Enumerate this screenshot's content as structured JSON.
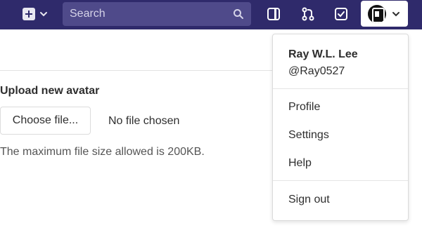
{
  "navbar": {
    "search_placeholder": "Search",
    "icons": [
      "plus-square-icon",
      "chevron-down-icon",
      "search-icon",
      "sidebar-toggle-icon",
      "merge-request-icon",
      "todo-check-icon",
      "user-avatar",
      "chevron-down-icon"
    ]
  },
  "avatar_section": {
    "title": "Upload new avatar",
    "choose_button": "Choose file...",
    "file_status": "No file chosen",
    "help_text": "The maximum file size allowed is 200KB."
  },
  "user_menu": {
    "name": "Ray W.L. Lee",
    "username": "@Ray0527",
    "items": [
      "Profile",
      "Settings",
      "Help"
    ],
    "sign_out": "Sign out"
  },
  "colors": {
    "navbar_bg": "#2f2a6b",
    "search_bg": "#4f4a8a"
  }
}
